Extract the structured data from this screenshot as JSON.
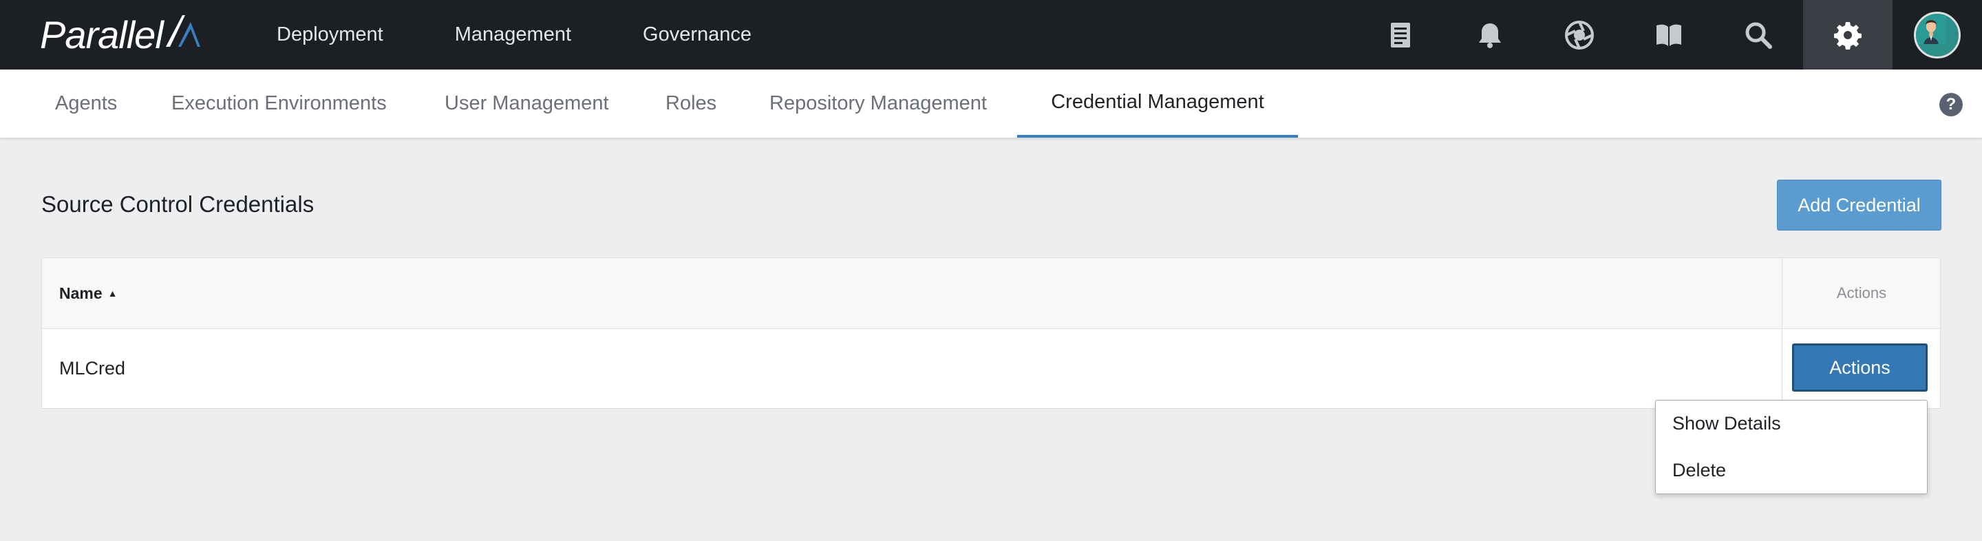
{
  "app": {
    "logo_text": "Parallel",
    "logo_mark": "M"
  },
  "topnav": {
    "items": [
      "Deployment",
      "Management",
      "Governance"
    ],
    "icons": [
      "document-icon",
      "bell-icon",
      "aperture-icon",
      "book-icon",
      "search-icon",
      "gear-icon",
      "avatar"
    ]
  },
  "subnav": {
    "tabs": [
      "Agents",
      "Execution Environments",
      "User Management",
      "Roles",
      "Repository Management",
      "Credential Management"
    ],
    "active": "Credential Management",
    "help": "?"
  },
  "page": {
    "title": "Source Control Credentials",
    "add_button": "Add Credential"
  },
  "table": {
    "columns": [
      "Name",
      "Actions"
    ],
    "rows": [
      {
        "name": "MLCred",
        "action_label": "Actions"
      }
    ]
  },
  "dropdown": {
    "items": [
      "Show Details",
      "Delete"
    ]
  },
  "colors": {
    "topbar": "#1c1f23",
    "accent": "#3a7fc1",
    "add_button": "#5a9bd0",
    "actions_button": "#3378b4"
  }
}
